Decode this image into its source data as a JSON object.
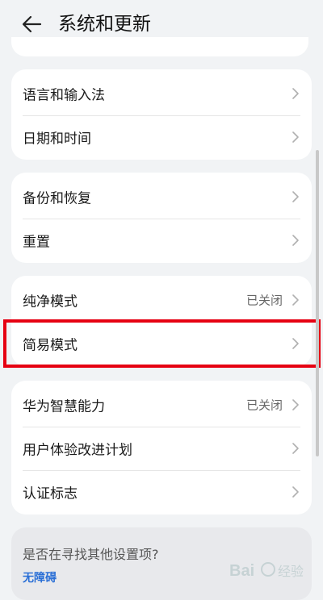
{
  "header": {
    "title": "系统和更新"
  },
  "groups": [
    {
      "rows": [
        {
          "label": "语言和输入法",
          "value": ""
        },
        {
          "label": "日期和时间",
          "value": ""
        }
      ]
    },
    {
      "rows": [
        {
          "label": "备份和恢复",
          "value": ""
        },
        {
          "label": "重置",
          "value": ""
        }
      ]
    },
    {
      "rows": [
        {
          "label": "纯净模式",
          "value": "已关闭"
        },
        {
          "label": "简易模式",
          "value": ""
        }
      ]
    },
    {
      "rows": [
        {
          "label": "华为智慧能力",
          "value": "已关闭"
        },
        {
          "label": "用户体验改进计划",
          "value": ""
        },
        {
          "label": "认证标志",
          "value": ""
        }
      ]
    }
  ],
  "suggestion": {
    "question": "是否在寻找其他设置项?",
    "link": "无障碍"
  },
  "watermark": {
    "text": "Bai经验"
  },
  "colors": {
    "highlight": "#e60012",
    "link": "#2a6fd6",
    "background": "#f1f3f5"
  }
}
